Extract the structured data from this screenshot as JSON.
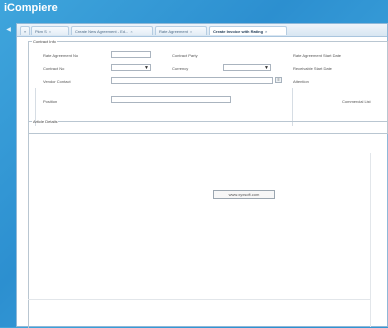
{
  "app": {
    "title": "iCompiere"
  },
  "tabs": [
    {
      "label": "Pkm S",
      "active": false
    },
    {
      "label": "Create New Agreement - Ed...",
      "active": false
    },
    {
      "label": "Rate Agreement",
      "active": false
    },
    {
      "label": "Create Invoice with Rating",
      "active": true
    }
  ],
  "contract_info": {
    "legend": "Contract Info",
    "rate_agreement_no_label": "Rate Agreement No",
    "contract_party_label": "Contract Party",
    "rate_agreement_start_date_label": "Rate Agreement Start Date",
    "contract_no_label": "Contract No",
    "currency_label": "Currency",
    "receivable_start_date_label": "Receivable Start Date",
    "vendor_contact_label": "Vendor Contact",
    "attention_label": "Attention",
    "position_label": "Position",
    "commercial_label": "Commercial List"
  },
  "article_details": {
    "legend": "Article Details"
  },
  "watermark": {
    "text": "www.xyxsoft.com"
  }
}
